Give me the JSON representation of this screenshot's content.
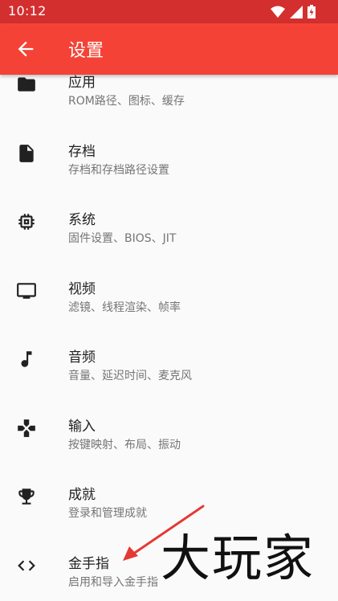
{
  "status_bar": {
    "time": "10:12"
  },
  "app_bar": {
    "title": "设置",
    "back_icon": "arrow-back-icon"
  },
  "settings": [
    {
      "label": "应用",
      "sub": "ROM路径、图标、缓存",
      "icon": "folder-icon"
    },
    {
      "label": "存档",
      "sub": "存档和存档路径设置",
      "icon": "file-icon"
    },
    {
      "label": "系统",
      "sub": "固件设置、BIOS、JIT",
      "icon": "chip-icon"
    },
    {
      "label": "视频",
      "sub": "滤镜、线程渲染、帧率",
      "icon": "monitor-icon"
    },
    {
      "label": "音频",
      "sub": "音量、延迟时间、麦克风",
      "icon": "music-note-icon"
    },
    {
      "label": "输入",
      "sub": "按键映射、布局、振动",
      "icon": "gamepad-icon"
    },
    {
      "label": "成就",
      "sub": "登录和管理成就",
      "icon": "trophy-icon"
    },
    {
      "label": "金手指",
      "sub": "启用和导入金手指",
      "icon": "code-icon"
    }
  ],
  "watermark": "大玩家",
  "colors": {
    "status_bar": "#d32f2f",
    "app_bar": "#f44336",
    "arrow": "#e53935"
  }
}
